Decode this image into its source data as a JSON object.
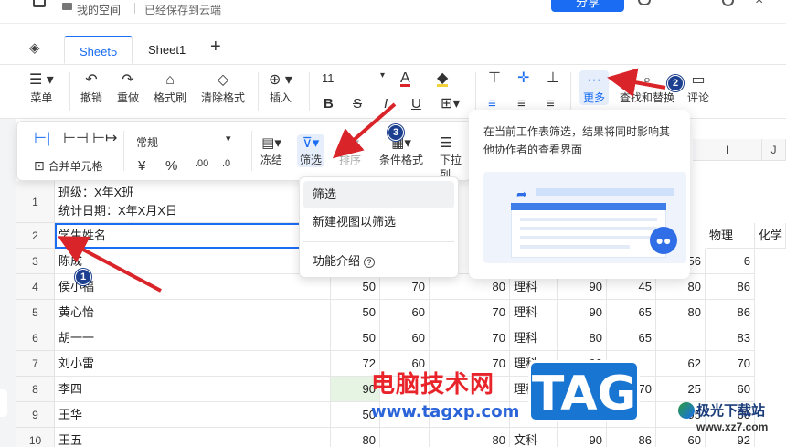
{
  "topbar": {
    "space_label": "我的空间",
    "saved_status": "已经保存到云端",
    "share_label": "分享"
  },
  "tabs": [
    {
      "label": "Sheet5",
      "active": true
    },
    {
      "label": "Sheet1",
      "active": false
    }
  ],
  "toolbar": {
    "menu": "菜单",
    "undo": "撤销",
    "redo": "重做",
    "format_painter": "格式刷",
    "clear_format": "清除格式",
    "insert": "插入",
    "font_size": "11",
    "more": "更多",
    "find_replace": "查找和替换",
    "comment": "评论"
  },
  "subtoolbar": {
    "merge": "合并单元格",
    "number_format": "常规",
    "freeze": "冻结",
    "filter": "筛选",
    "sort": "排序",
    "conditional": "条件格式",
    "dropdown_list": "下拉列"
  },
  "filter_menu": {
    "items": [
      "筛选",
      "新建视图以筛选"
    ],
    "help": "功能介绍"
  },
  "tooltip": {
    "text": "在当前工作表筛选，结果将同时影响其他协作者的查看界面"
  },
  "columns": {
    "I": "I",
    "J": "J"
  },
  "rows": [
    {
      "n": "1",
      "a": "班级：X年X班",
      "a2": "统计日期：X年X月X日"
    },
    {
      "n": "2",
      "a": "学生姓名",
      "h": [
        "物理",
        "化学"
      ]
    },
    {
      "n": "3",
      "a": "陈成",
      "v": [
        "",
        "",
        "",
        "",
        "",
        "95",
        "56",
        "6"
      ]
    },
    {
      "n": "4",
      "a": "侯小福",
      "v": [
        "50",
        "70",
        "80",
        "理科",
        "90",
        "45",
        "80",
        "86"
      ]
    },
    {
      "n": "5",
      "a": "黄心怡",
      "v": [
        "50",
        "60",
        "70",
        "理科",
        "90",
        "65",
        "80",
        "86"
      ]
    },
    {
      "n": "6",
      "a": "胡一一",
      "v": [
        "50",
        "60",
        "70",
        "理科",
        "80",
        "65",
        "",
        "83"
      ]
    },
    {
      "n": "7",
      "a": "刘小雷",
      "v": [
        "72",
        "60",
        "70",
        "理科",
        "90",
        "",
        "62",
        "70"
      ]
    },
    {
      "n": "8",
      "a": "李四",
      "v": [
        "90",
        "",
        "",
        "理科",
        "",
        "70",
        "25",
        "60"
      ]
    },
    {
      "n": "9",
      "a": "王华",
      "v": [
        "50",
        "",
        "",
        "",
        "",
        "",
        "95",
        "60"
      ]
    },
    {
      "n": "10",
      "a": "王五",
      "v": [
        "80",
        "",
        "80",
        "文科",
        "90",
        "86",
        "60",
        "92"
      ]
    }
  ],
  "annotations": {
    "badge1": "1",
    "badge2": "2",
    "badge3": "3"
  },
  "watermark": {
    "cn": "电脑技术网",
    "url": "www.tagxp.com",
    "tag": "TAG",
    "site": "极光下载站",
    "site_url": "www.xz7.com"
  },
  "colors": {
    "accent": "#1a6df2",
    "annotation_arrow": "#d9252a",
    "badge": "#1d3f8f"
  }
}
